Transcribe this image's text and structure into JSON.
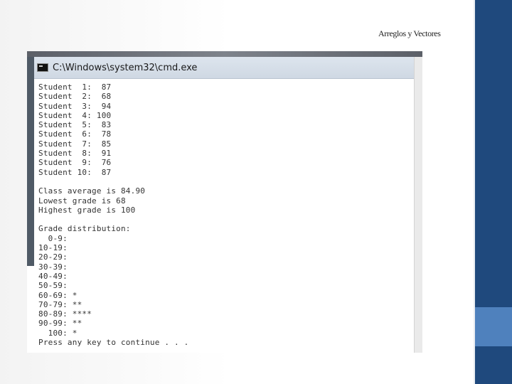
{
  "slide": {
    "title": "Arreglos y Vectores"
  },
  "window": {
    "title": "C:\\Windows\\system32\\cmd.exe",
    "icon": "console-icon"
  },
  "console": {
    "lines": [
      "Student  1:  87",
      "Student  2:  68",
      "Student  3:  94",
      "Student  4: 100",
      "Student  5:  83",
      "Student  6:  78",
      "Student  7:  85",
      "Student  8:  91",
      "Student  9:  76",
      "Student 10:  87",
      "",
      "Class average is 84.90",
      "Lowest grade is 68",
      "Highest grade is 100",
      "",
      "Grade distribution:",
      "  0-9:",
      "10-19:",
      "20-29:",
      "30-39:",
      "40-49:",
      "50-59:",
      "60-69: *",
      "70-79: **",
      "80-89: ****",
      "90-99: **",
      "  100: *",
      "Press any key to continue . . ."
    ]
  },
  "colors": {
    "sidebar": "#1f497d",
    "accent": "#4f81bd"
  }
}
